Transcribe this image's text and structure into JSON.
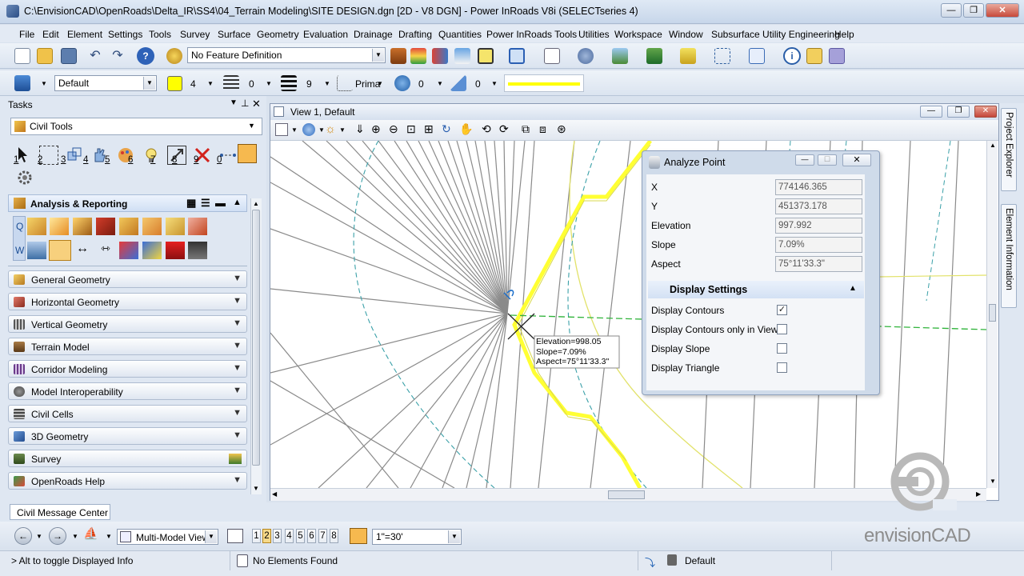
{
  "window": {
    "title": "C:\\EnvisionCAD\\OpenRoads\\Delta_IR\\SS4\\04_Terrain Modeling\\SITE DESIGN.dgn [2D - V8 DGN] - Power InRoads V8i (SELECTseries 4)",
    "minimize": "—",
    "restore": "❐",
    "close": "✕"
  },
  "menu": [
    "File",
    "Edit",
    "Element",
    "Settings",
    "Tools",
    "Survey",
    "Surface",
    "Geometry",
    "Evaluation",
    "Drainage",
    "Drafting",
    "Quantities",
    "Power InRoads Tools",
    "Utilities",
    "Workspace",
    "Window",
    "Subsurface Utility Engineering",
    "Help"
  ],
  "toolbar1": {
    "feature_definition": "No Feature Definition"
  },
  "toolbar2": {
    "level": "Default",
    "color_value": "4",
    "line_style_value": "0",
    "weight_value": "9",
    "class_value": "Prima",
    "transparency_value": "0",
    "priority_value": "0",
    "active_color": "#ffff00"
  },
  "tasks": {
    "header": "Tasks",
    "pin": "⊥",
    "close": "✕",
    "selector": "Civil Tools",
    "tool_numbers": [
      "1",
      "2",
      "3",
      "4",
      "5",
      "6",
      "7",
      "8",
      "9",
      "0"
    ],
    "analysis_section": "Analysis & Reporting",
    "q_label": "Q",
    "w_label": "W",
    "sections": [
      "General Geometry",
      "Horizontal Geometry",
      "Vertical Geometry",
      "Terrain Model",
      "Corridor Modeling",
      "Model Interoperability",
      "Civil Cells",
      "3D Geometry",
      "Survey",
      "OpenRoads Help"
    ]
  },
  "view": {
    "title": "View 1, Default",
    "tooltip": [
      "Elevation=998.05",
      "Slope=7.09%",
      "Aspect=75°11'33.3\""
    ]
  },
  "analyze_point": {
    "title": "Analyze Point",
    "fields": [
      {
        "label": "X",
        "value": "774146.365"
      },
      {
        "label": "Y",
        "value": "451373.178"
      },
      {
        "label": "Elevation",
        "value": "997.992"
      },
      {
        "label": "Slope",
        "value": "7.09%"
      },
      {
        "label": "Aspect",
        "value": "75°11'33.3\""
      }
    ],
    "display_settings_header": "Display Settings",
    "options": [
      {
        "label": "Display Contours",
        "checked": true
      },
      {
        "label": "Display Contours only in View",
        "checked": false
      },
      {
        "label": "Display Slope",
        "checked": false
      },
      {
        "label": "Display Triangle",
        "checked": false
      }
    ]
  },
  "right_tabs": [
    "Project Explorer",
    "Element Information"
  ],
  "message_center": {
    "tab": "Civil Message Center"
  },
  "bottom_toolbar": {
    "view_group": "Multi-Model Views",
    "view_numbers": [
      "1",
      "2",
      "3",
      "4",
      "5",
      "6",
      "7",
      "8"
    ],
    "scale": "1\"=30'"
  },
  "status": {
    "prompt": "> Alt to toggle Displayed Info",
    "selection": "No Elements Found",
    "level": "Default"
  },
  "logo": {
    "text": "envisionCAD"
  }
}
